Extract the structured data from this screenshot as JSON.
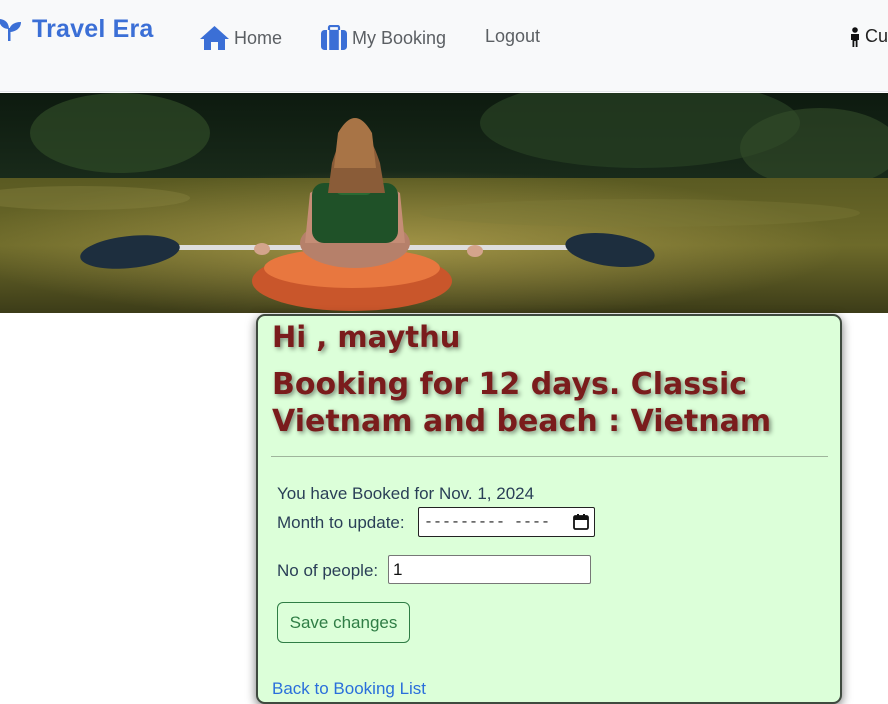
{
  "navbar": {
    "brand": "Travel Era",
    "brand_icon": "sprout-icon",
    "items": [
      {
        "label": "Home",
        "icon": "home-icon"
      },
      {
        "label": "My Booking",
        "icon": "suitcase-icon"
      },
      {
        "label": "Logout"
      }
    ],
    "user_label": "Cu",
    "user_icon": "person-icon"
  },
  "hero": {
    "image": "photo of a woman in a kayak on a river"
  },
  "booking": {
    "greeting": "Hi , maythu",
    "title": "Booking for 12 days. Classic Vietnam and beach : Vietnam",
    "booked_text": "You have Booked for Nov. 1, 2024",
    "month_label": "Month to update:",
    "month_placeholder": "--------- ----",
    "people_label": "No of people:",
    "people_value": "1",
    "save_label": "Save changes",
    "back_link": "Back to Booking List"
  },
  "colors": {
    "brand": "#3b6fd6",
    "card_bg": "#dcffd9",
    "title": "#7a1c1c",
    "save_button": "#2f7d45",
    "link": "#2a6fdb"
  }
}
